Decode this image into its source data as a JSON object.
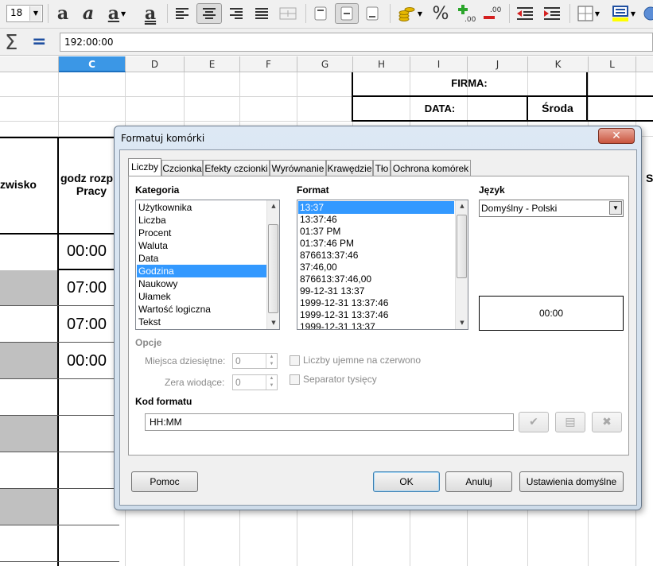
{
  "toolbar": {
    "font_size": "18",
    "icons": [
      "bold-a-icon",
      "italic-a-icon",
      "underline-a-icon",
      "double-underline-a-icon",
      "align-left-icon",
      "align-center-icon",
      "align-right-icon",
      "justify-icon",
      "merge-cells-icon",
      "valign-top-icon",
      "valign-center-icon",
      "valign-bottom-icon",
      "currency-icon",
      "percent-icon",
      "add-decimal-icon",
      "remove-decimal-icon",
      "decrease-indent-icon",
      "increase-indent-icon",
      "borders-icon",
      "background-color-icon"
    ],
    "percent_glyph": "%"
  },
  "formula_bar": {
    "sigma": "Σ",
    "equals": "=",
    "value": "192:00:00"
  },
  "sheet": {
    "columns": [
      "C",
      "D",
      "E",
      "F",
      "G",
      "H",
      "I",
      "J",
      "K",
      "L"
    ],
    "selected_column": "C",
    "firma_label": "FIRMA:",
    "data_label": "DATA:",
    "day_value": "Środa",
    "surname_partial": "zwisko",
    "start_header_line1": "godz rozp",
    "start_header_line2": "Pracy",
    "right_partial": "S",
    "times": [
      "00:00",
      "07:00",
      "07:00",
      "00:00"
    ]
  },
  "dialog": {
    "title": "Formatuj komórki",
    "close_glyph": "✕",
    "tabs": [
      "Liczby",
      "Czcionka",
      "Efekty czcionki",
      "Wyrównanie",
      "Krawędzie",
      "Tło",
      "Ochrona komórek"
    ],
    "active_tab": "Liczby",
    "category": {
      "label": "Kategoria",
      "items": [
        "Użytkownika",
        "Liczba",
        "Procent",
        "Waluta",
        "Data",
        "Godzina",
        "Naukowy",
        "Ułamek",
        "Wartość logiczna",
        "Tekst"
      ],
      "selected": "Godzina"
    },
    "format": {
      "label": "Format",
      "items": [
        "13:37",
        "13:37:46",
        "01:37 PM",
        "01:37:46 PM",
        "876613:37:46",
        "37:46,00",
        "876613:37:46,00",
        "99-12-31 13:37",
        "1999-12-31 13:37:46",
        "1999-12-31 13:37:46",
        "1999-12-31 13:37"
      ],
      "selected": "13:37"
    },
    "language": {
      "label": "Język",
      "value": "Domyślny - Polski"
    },
    "preview": "00:00",
    "options": {
      "label": "Opcje",
      "decimal_places_label": "Miejsca dziesiętne:",
      "decimal_places_value": "0",
      "leading_zeros_label": "Zera wiodące:",
      "leading_zeros_value": "0",
      "negative_red_label": "Liczby ujemne na czerwono",
      "thousands_sep_label": "Separator tysięcy"
    },
    "format_code": {
      "label": "Kod formatu",
      "value": "HH:MM"
    },
    "buttons": {
      "help": "Pomoc",
      "ok": "OK",
      "cancel": "Anuluj",
      "reset": "Ustawienia domyślne"
    }
  }
}
